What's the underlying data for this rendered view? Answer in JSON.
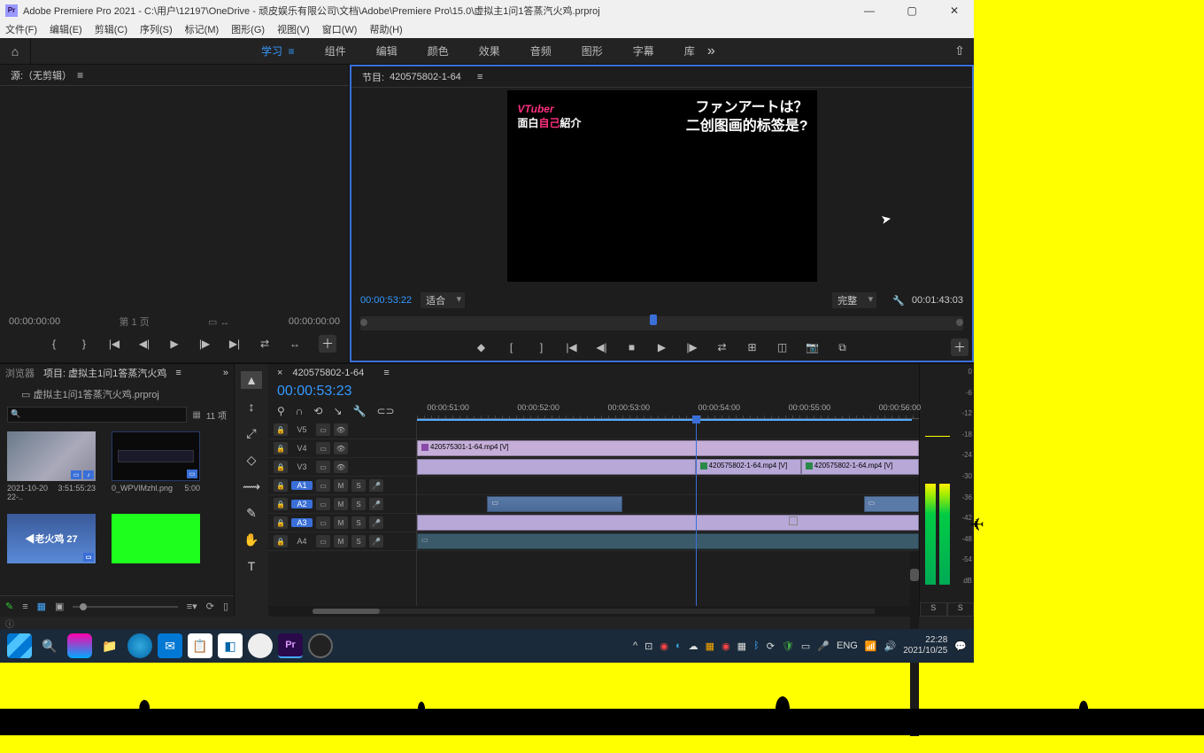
{
  "window": {
    "app_icon": "Pr",
    "title": "Adobe Premiere Pro 2021 - C:\\用户\\12197\\OneDrive - 顽皮娱乐有限公司\\文档\\Adobe\\Premiere Pro\\15.0\\虚拟主1问1答蒸汽火鸡.prproj",
    "min": "—",
    "max": "▢",
    "close": "✕"
  },
  "menu": [
    "文件(F)",
    "编辑(E)",
    "剪辑(C)",
    "序列(S)",
    "标记(M)",
    "图形(G)",
    "视图(V)",
    "窗口(W)",
    "帮助(H)"
  ],
  "workspace": {
    "home": "⌂",
    "tabs": [
      "学习",
      "组件",
      "编辑",
      "颜色",
      "效果",
      "音频",
      "图形",
      "字幕",
      "库"
    ],
    "tabs_more": "»",
    "active": "学习",
    "share": "⇧"
  },
  "source": {
    "tab": "源:（无剪辑）",
    "menu": "≡",
    "left_tc": "00:00:00:00",
    "page": "第 1 页",
    "right_tc": "00:00:00:00",
    "tools": [
      "{",
      "}",
      "|◀",
      "◀|",
      "▶",
      "|▶",
      "▶|",
      "⇄",
      "↔",
      "＋"
    ]
  },
  "program": {
    "tab_prefix": "节目:",
    "tab_name": "420575802-1-64",
    "menu": "≡",
    "video": {
      "logo1": "VTuber",
      "logo2a": "面白",
      "logo2b": "自己",
      "logo2c": "紹介",
      "line1": "ファンアートは？",
      "line2": "二创图画的标签是?"
    },
    "left_tc": "00:00:53:22",
    "fit": "适合",
    "quality": "完整",
    "right_tc": "00:01:43:03",
    "transport": [
      "◆",
      "[",
      "]",
      "|◀",
      "◀|",
      "■",
      "▶",
      "|▶",
      "⇄",
      "⊞",
      "◫",
      "📷",
      "⧉",
      "＋"
    ]
  },
  "project": {
    "tabs": {
      "browser": "浏览器",
      "project": "项目: 虚拟主1问1答蒸汽火鸡",
      "menu": "≡",
      "more": "»"
    },
    "file": "虚拟主1问1答蒸汽火鸡.prproj",
    "count": "11 项",
    "items": [
      {
        "name": "2021-10-20 22-..",
        "dur": "3:51:55:23"
      },
      {
        "name": "0_WPVlMzhl.png",
        "dur": "5:00"
      },
      {
        "name": "◀老火鸡 27",
        "dur": ""
      },
      {
        "name": "",
        "dur": ""
      }
    ],
    "footer_icons": [
      "✎",
      "≡",
      "▦",
      "▣",
      "O—",
      "≡▾",
      "⟳",
      "▯"
    ]
  },
  "tools": [
    "▲",
    "↕",
    "⤢",
    "◇",
    "⟿",
    "✎",
    "✋",
    "T"
  ],
  "timeline": {
    "tab": "420575802-1-64",
    "menu": "≡",
    "timecode": "00:00:53:23",
    "icons": [
      "⚲",
      "∩",
      "⟲",
      "↘",
      "🔧",
      "⊂⊃"
    ],
    "ruler": [
      "00:00:51:00",
      "00:00:52:00",
      "00:00:53:00",
      "00:00:54:00",
      "00:00:55:00",
      "00:00:56:00"
    ],
    "video_tracks": [
      "V5",
      "V4",
      "V3"
    ],
    "audio_tracks": [
      "A1",
      "A2",
      "A3",
      "A4"
    ],
    "th_btns": {
      "lock": "🔒",
      "eye": "👁",
      "cut": "▭",
      "m": "M",
      "s": "S",
      "mic": "🎤"
    },
    "clips": {
      "v4": "420575301-1-64.mp4 [V]",
      "v3a": "420575802-1-64.mp4 [V]",
      "v3b": "420575802-1-64.mp4 [V]"
    }
  },
  "meters": {
    "scale": [
      "0",
      "-6",
      "-12",
      "-18",
      "-24",
      "-30",
      "-36",
      "-42",
      "-48",
      "-54",
      "dB"
    ],
    "solo": "S"
  },
  "taskbar": {
    "icons": [
      "",
      "🔍",
      "▲",
      "📁",
      "🌐",
      "✉",
      "📋",
      "◧",
      "⬤",
      "Pr",
      "◑"
    ],
    "tray": [
      "^",
      "⊡",
      "⊛",
      "◐",
      "☁",
      "⊞",
      "◉",
      "▦",
      "⚡",
      "⟳",
      "🛡",
      "▭",
      "🎤"
    ],
    "lang": "ENG",
    "net": "📶",
    "vol": "🔊",
    "time": "22:28",
    "date": "2021/10/25",
    "notif": "💬"
  }
}
